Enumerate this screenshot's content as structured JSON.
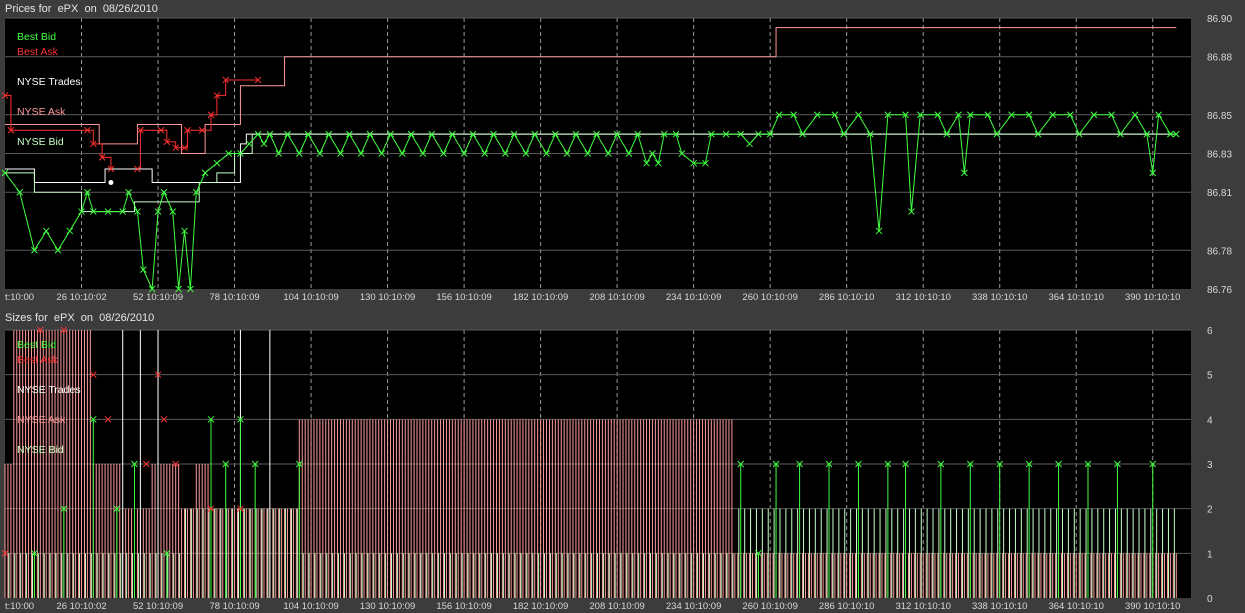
{
  "colors": {
    "best_bid": "#40ff40",
    "best_ask": "#ff3030",
    "nyse_trades": "#ffffff",
    "nyse_ask": "#ff9a9a",
    "nyse_bid": "#c8ffc8",
    "plot_bg": "#000000",
    "frame_bg": "#3c3c3c",
    "grid": "#9a9a9a"
  },
  "chart_data": [
    {
      "type": "line",
      "title": "Prices for  ePX  on  08/26/2010",
      "x_tick_labels": [
        "t:10:00",
        "26 10:10:02",
        "52 10:10:09",
        "78 10:10:09",
        "104 10:10:09",
        "130 10:10:09",
        "156 10:10:09",
        "182 10:10:09",
        "208 10:10:09",
        "234 10:10:09",
        "260 10:10:09",
        "286 10:10:10",
        "312 10:10:10",
        "338 10:10:10",
        "364 10:10:10",
        "390 10:10:10"
      ],
      "x_tick_values": [
        0,
        26,
        52,
        78,
        104,
        130,
        156,
        182,
        208,
        234,
        260,
        286,
        312,
        338,
        364,
        390
      ],
      "xlim": [
        0,
        403
      ],
      "y_tick_labels": [
        "86.76",
        "86.78",
        "86.81",
        "86.83",
        "86.85",
        "86.88",
        "86.90"
      ],
      "y_tick_values": [
        86.76,
        86.78,
        86.81,
        86.83,
        86.85,
        86.88,
        86.9
      ],
      "ylim": [
        86.76,
        86.9
      ],
      "grid": true,
      "legend": [
        "Best Bid",
        "Best Ask",
        "NYSE Trades",
        "NYSE Ask",
        "NYSE Bid"
      ],
      "series": [
        {
          "name": "NYSE Ask",
          "step": true,
          "points": [
            [
              0,
              86.845
            ],
            [
              3,
              86.845
            ],
            [
              32,
              86.835
            ],
            [
              45,
              86.845
            ],
            [
              60,
              86.83
            ],
            [
              68,
              86.845
            ],
            [
              80,
              86.865
            ],
            [
              95,
              86.88
            ],
            [
              240,
              86.88
            ],
            [
              262,
              86.895
            ],
            [
              398,
              86.895
            ]
          ]
        },
        {
          "name": "Best Ask",
          "step": true,
          "points": [
            [
              0,
              86.86
            ],
            [
              2,
              86.842
            ],
            [
              28,
              86.842
            ],
            [
              30,
              86.835
            ],
            [
              33,
              86.828
            ],
            [
              36,
              86.822
            ],
            [
              45,
              86.822
            ],
            [
              46,
              86.842
            ],
            [
              53,
              86.842
            ],
            [
              55,
              86.836
            ],
            [
              58,
              86.833
            ],
            [
              61,
              86.833
            ],
            [
              62,
              86.842
            ],
            [
              67,
              86.842
            ],
            [
              70,
              86.85
            ],
            [
              72,
              86.86
            ],
            [
              75,
              86.868
            ],
            [
              86,
              86.868
            ]
          ]
        },
        {
          "name": "NYSE Trades",
          "step": true,
          "points": [
            [
              0,
              86.822
            ],
            [
              10,
              86.815
            ],
            [
              30,
              86.815
            ],
            [
              34,
              86.822
            ],
            [
              47,
              86.822
            ],
            [
              50,
              86.815
            ],
            [
              78,
              86.815
            ],
            [
              80,
              86.835
            ],
            [
              82,
              86.84
            ],
            [
              262,
              86.84
            ],
            [
              398,
              86.84
            ]
          ]
        },
        {
          "name": "NYSE Bid",
          "step": true,
          "points": [
            [
              0,
              86.82
            ],
            [
              10,
              86.81
            ],
            [
              25,
              86.81
            ],
            [
              26,
              86.8
            ],
            [
              38,
              86.8
            ],
            [
              44,
              86.805
            ],
            [
              60,
              86.805
            ],
            [
              66,
              86.815
            ],
            [
              72,
              86.82
            ],
            [
              78,
              86.83
            ],
            [
              84,
              86.84
            ],
            [
              262,
              86.84
            ],
            [
              398,
              86.84
            ]
          ]
        },
        {
          "name": "Best Bid",
          "step": false,
          "points": [
            [
              0,
              86.82
            ],
            [
              5,
              86.81
            ],
            [
              10,
              86.78
            ],
            [
              14,
              86.79
            ],
            [
              18,
              86.78
            ],
            [
              22,
              86.79
            ],
            [
              26,
              86.8
            ],
            [
              28,
              86.81
            ],
            [
              30,
              86.8
            ],
            [
              35,
              86.8
            ],
            [
              40,
              86.8
            ],
            [
              42,
              86.81
            ],
            [
              45,
              86.8
            ],
            [
              47,
              86.77
            ],
            [
              50,
              86.76
            ],
            [
              52,
              86.8
            ],
            [
              54,
              86.81
            ],
            [
              57,
              86.8
            ],
            [
              59,
              86.76
            ],
            [
              61,
              86.79
            ],
            [
              63,
              86.76
            ],
            [
              65,
              86.81
            ],
            [
              68,
              86.82
            ],
            [
              72,
              86.825
            ],
            [
              76,
              86.83
            ],
            [
              80,
              86.83
            ],
            [
              83,
              86.835
            ],
            [
              86,
              86.84
            ],
            [
              88,
              86.835
            ],
            [
              90,
              86.84
            ],
            [
              93,
              86.83
            ],
            [
              96,
              86.84
            ],
            [
              100,
              86.83
            ],
            [
              103,
              86.84
            ],
            [
              107,
              86.83
            ],
            [
              110,
              86.84
            ],
            [
              114,
              86.83
            ],
            [
              117,
              86.84
            ],
            [
              121,
              86.83
            ],
            [
              124,
              86.84
            ],
            [
              128,
              86.83
            ],
            [
              131,
              86.84
            ],
            [
              135,
              86.83
            ],
            [
              138,
              86.84
            ],
            [
              142,
              86.83
            ],
            [
              145,
              86.84
            ],
            [
              149,
              86.83
            ],
            [
              152,
              86.84
            ],
            [
              156,
              86.83
            ],
            [
              159,
              86.84
            ],
            [
              163,
              86.83
            ],
            [
              166,
              86.84
            ],
            [
              170,
              86.83
            ],
            [
              173,
              86.84
            ],
            [
              177,
              86.83
            ],
            [
              180,
              86.84
            ],
            [
              184,
              86.83
            ],
            [
              187,
              86.84
            ],
            [
              191,
              86.83
            ],
            [
              194,
              86.84
            ],
            [
              198,
              86.83
            ],
            [
              201,
              86.84
            ],
            [
              205,
              86.83
            ],
            [
              208,
              86.84
            ],
            [
              212,
              86.83
            ],
            [
              215,
              86.84
            ],
            [
              218,
              86.825
            ],
            [
              220,
              86.83
            ],
            [
              222,
              86.825
            ],
            [
              224,
              86.84
            ],
            [
              228,
              86.84
            ],
            [
              230,
              86.83
            ],
            [
              234,
              86.825
            ],
            [
              238,
              86.825
            ],
            [
              240,
              86.84
            ],
            [
              245,
              86.84
            ],
            [
              250,
              86.84
            ],
            [
              253,
              86.835
            ],
            [
              256,
              86.84
            ],
            [
              260,
              86.84
            ],
            [
              263,
              86.85
            ],
            [
              268,
              86.85
            ],
            [
              271,
              86.84
            ],
            [
              276,
              86.85
            ],
            [
              282,
              86.85
            ],
            [
              285,
              86.84
            ],
            [
              290,
              86.85
            ],
            [
              294,
              86.84
            ],
            [
              297,
              86.79
            ],
            [
              300,
              86.85
            ],
            [
              306,
              86.85
            ],
            [
              308,
              86.8
            ],
            [
              311,
              86.85
            ],
            [
              317,
              86.85
            ],
            [
              320,
              86.84
            ],
            [
              324,
              86.85
            ],
            [
              326,
              86.82
            ],
            [
              328,
              86.85
            ],
            [
              334,
              86.85
            ],
            [
              337,
              86.84
            ],
            [
              342,
              86.85
            ],
            [
              348,
              86.85
            ],
            [
              351,
              86.84
            ],
            [
              356,
              86.85
            ],
            [
              362,
              86.85
            ],
            [
              365,
              86.84
            ],
            [
              370,
              86.85
            ],
            [
              376,
              86.85
            ],
            [
              379,
              86.84
            ],
            [
              384,
              86.85
            ],
            [
              388,
              86.84
            ],
            [
              390,
              86.82
            ],
            [
              392,
              86.85
            ],
            [
              396,
              86.84
            ],
            [
              398,
              86.84
            ]
          ]
        }
      ]
    },
    {
      "type": "bar",
      "title": "Sizes for  ePX  on  08/26/2010",
      "x_tick_labels": [
        "t:10:00",
        "26 10:10:02",
        "52 10:10:09",
        "78 10:10:09",
        "104 10:10:09",
        "130 10:10:09",
        "156 10:10:09",
        "182 10:10:09",
        "208 10:10:09",
        "234 10:10:09",
        "260 10:10:09",
        "286 10:10:10",
        "312 10:10:10",
        "338 10:10:10",
        "364 10:10:10",
        "390 10:10:10"
      ],
      "x_tick_values": [
        0,
        26,
        52,
        78,
        104,
        130,
        156,
        182,
        208,
        234,
        260,
        286,
        312,
        338,
        364,
        390
      ],
      "xlim": [
        0,
        403
      ],
      "y_tick_labels": [
        "0",
        "1",
        "2",
        "3",
        "4",
        "5",
        "6"
      ],
      "y_tick_values": [
        0,
        1,
        2,
        3,
        4,
        5,
        6
      ],
      "ylim": [
        0,
        6
      ],
      "grid": true,
      "legend": [
        "Best Bid",
        "Best Ask",
        "NYSE Trades",
        "NYSE Ask",
        "NYSE Bid"
      ],
      "ask_size_profile": [
        [
          0,
          3
        ],
        [
          3,
          6
        ],
        [
          30,
          3
        ],
        [
          40,
          2
        ],
        [
          50,
          3
        ],
        [
          60,
          2
        ],
        [
          65,
          3
        ],
        [
          70,
          2
        ],
        [
          100,
          4
        ],
        [
          248,
          1
        ],
        [
          398,
          1
        ]
      ],
      "bid_size_profile": [
        [
          0,
          1
        ],
        [
          30,
          1
        ],
        [
          60,
          2
        ],
        [
          100,
          1
        ],
        [
          248,
          2
        ],
        [
          398,
          2
        ]
      ],
      "trade_sizes": [
        [
          40,
          6
        ],
        [
          46,
          6
        ],
        [
          52,
          6
        ],
        [
          80,
          6
        ],
        [
          90,
          6
        ]
      ],
      "best_bid_sizes": [
        [
          10,
          1
        ],
        [
          20,
          2
        ],
        [
          30,
          4
        ],
        [
          38,
          2
        ],
        [
          44,
          3
        ],
        [
          55,
          1
        ],
        [
          70,
          4
        ],
        [
          75,
          3
        ],
        [
          80,
          4
        ],
        [
          85,
          3
        ],
        [
          100,
          3
        ],
        [
          250,
          3
        ],
        [
          256,
          1
        ],
        [
          262,
          3
        ],
        [
          270,
          3
        ],
        [
          280,
          3
        ],
        [
          290,
          3
        ],
        [
          300,
          3
        ],
        [
          306,
          3
        ],
        [
          318,
          3
        ],
        [
          328,
          3
        ],
        [
          338,
          3
        ],
        [
          348,
          3
        ],
        [
          358,
          3
        ],
        [
          368,
          3
        ],
        [
          378,
          3
        ],
        [
          390,
          3
        ]
      ],
      "best_ask_sizes": [
        [
          0,
          1
        ],
        [
          12,
          6
        ],
        [
          20,
          6
        ],
        [
          30,
          5
        ],
        [
          35,
          4
        ],
        [
          48,
          3
        ],
        [
          52,
          5
        ],
        [
          54,
          4
        ],
        [
          58,
          3
        ],
        [
          70,
          2
        ],
        [
          80,
          2
        ]
      ]
    }
  ]
}
